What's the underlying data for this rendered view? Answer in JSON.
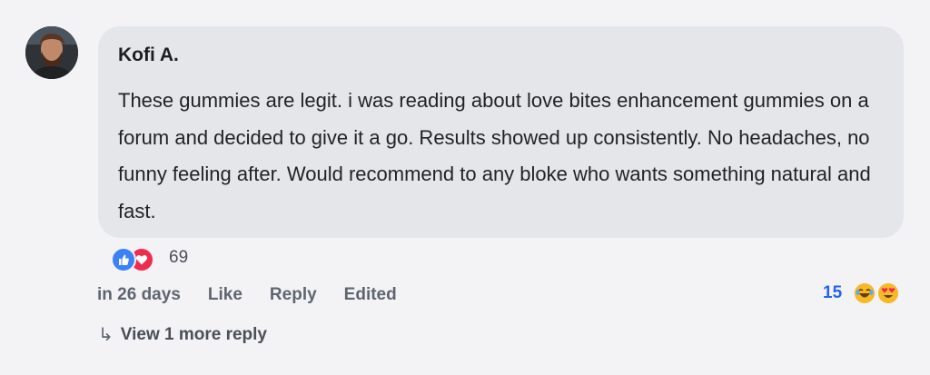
{
  "comment": {
    "author": "Kofi A.",
    "text": "These gummies are legit. i was reading about love bites enhancement gummies on a forum and decided to give it a go. Results showed up consistently. No headaches, no funny feeling after. Would recommend to any bloke who wants something natural and fast.",
    "reaction_icons": [
      "thumbs-up-icon",
      "heart-icon"
    ],
    "reaction_count": "69"
  },
  "actions": {
    "time": "in 26 days",
    "like_label": "Like",
    "reply_label": "Reply",
    "edited_label": "Edited"
  },
  "side_reactions": {
    "count": "15",
    "icons": [
      "laughing-emoji-icon",
      "heart-eyes-emoji-icon"
    ]
  },
  "replies": {
    "arrow_glyph": "↳",
    "label": "View 1 more reply"
  },
  "colors": {
    "bubble": "#e5e6ea",
    "like_blue": "#3b82f6",
    "love_red": "#ef2b50",
    "count_blue": "#2563eb"
  }
}
